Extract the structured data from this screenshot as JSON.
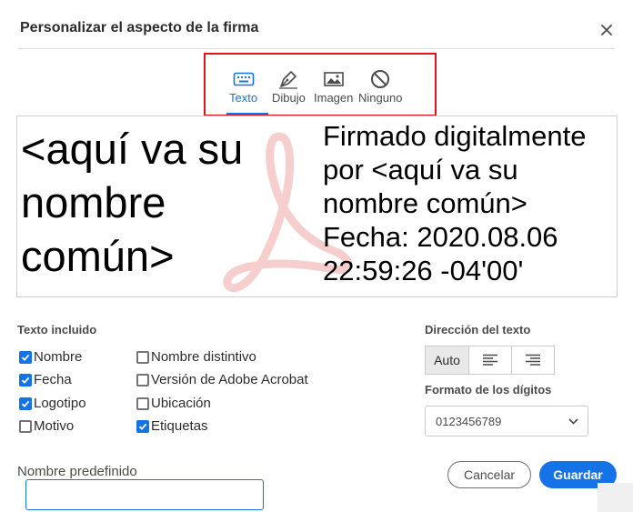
{
  "dialog": {
    "title": "Personalizar el aspecto de la firma"
  },
  "tabs": [
    {
      "label": "Texto",
      "icon": "keyboard-icon",
      "active": true
    },
    {
      "label": "Dibujo",
      "icon": "pen-nib-icon",
      "active": false
    },
    {
      "label": "Imagen",
      "icon": "image-icon",
      "active": false
    },
    {
      "label": "Ninguno",
      "icon": "prohibited-icon",
      "active": false
    }
  ],
  "preview": {
    "name_lines": [
      "<aquí va su",
      "nombre",
      "común>"
    ],
    "details_lines": [
      "Firmado digitalmente",
      "por <aquí va su",
      "nombre común>",
      "Fecha: 2020.08.06",
      "22:59:26 -04'00'"
    ]
  },
  "included_text": {
    "label": "Texto incluido",
    "options": [
      {
        "label": "Nombre",
        "checked": true
      },
      {
        "label": "Nombre distintivo",
        "checked": false
      },
      {
        "label": "Fecha",
        "checked": true
      },
      {
        "label": "Versión de Adobe Acrobat",
        "checked": false
      },
      {
        "label": "Logotipo",
        "checked": true
      },
      {
        "label": "Ubicación",
        "checked": false
      },
      {
        "label": "Motivo",
        "checked": false
      },
      {
        "label": "Etiquetas",
        "checked": true
      }
    ]
  },
  "text_direction": {
    "label": "Dirección del texto",
    "auto_label": "Auto",
    "selected": "Auto"
  },
  "digit_format": {
    "label": "Formato de los dígitos",
    "selected": "0123456789"
  },
  "predefined_name": {
    "label": "Nombre predefinido",
    "value": ""
  },
  "buttons": {
    "cancel": "Cancelar",
    "save": "Guardar"
  },
  "colors": {
    "accent": "#1473e6",
    "highlight_border": "#e0141e",
    "logo_watermark": "#f5c9c9"
  }
}
